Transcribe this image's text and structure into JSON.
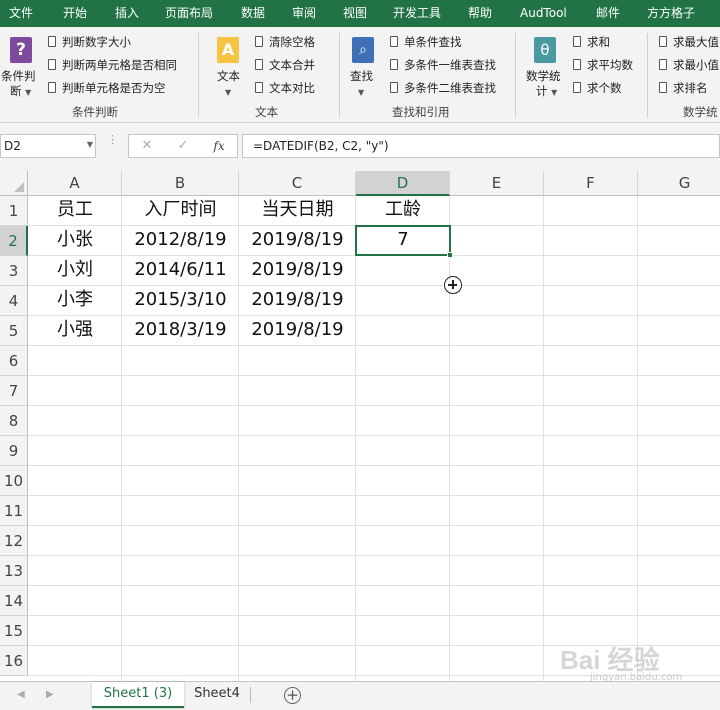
{
  "menu": {
    "items": [
      "文件",
      "开始",
      "插入",
      "页面布局",
      "数据",
      "审阅",
      "视图",
      "开发工具",
      "帮助",
      "AudTool",
      "邮件",
      "方方格子"
    ]
  },
  "ribbon": {
    "groups": {
      "condition": {
        "big_button_label_line1": "条件判",
        "big_button_label_line2": "断",
        "items": [
          "判断数字大小",
          "判断两单元格是否相同",
          "判断单元格是否为空"
        ],
        "group_label": "条件判断"
      },
      "text": {
        "big_button_label": "文本",
        "items": [
          "清除空格",
          "文本合并",
          "文本对比"
        ],
        "group_label": "文本"
      },
      "lookup": {
        "big_button_label": "查找",
        "items": [
          "单条件查找",
          "多条件一维表查找",
          "多条件二维表查找"
        ],
        "group_label": "查找和引用"
      },
      "stats": {
        "big_button_label_line1": "数学统",
        "big_button_label_line2": "计",
        "items": [
          "求和",
          "求平均数",
          "求个数"
        ]
      },
      "stats2": {
        "items": [
          "求最大值",
          "求最小值",
          "求排名"
        ],
        "group_label": "数学统"
      }
    }
  },
  "formula_bar": {
    "name_box": "D2",
    "formula": "=DATEDIF(B2, C2, \"y\")",
    "cancel_glyph": "✕",
    "enter_glyph": "✓",
    "fx_glyph": "fx"
  },
  "sheet": {
    "columns": [
      "A",
      "B",
      "C",
      "D",
      "E",
      "F",
      "G"
    ],
    "rows": [
      "1",
      "2",
      "3",
      "4",
      "5",
      "6",
      "7",
      "8",
      "9",
      "10",
      "11",
      "12",
      "13",
      "14",
      "15",
      "16"
    ],
    "header_row": [
      "员工",
      "入厂时间",
      "当天日期",
      "工龄"
    ],
    "data": [
      [
        "小张",
        "2012/8/19",
        "2019/8/19",
        "7"
      ],
      [
        "小刘",
        "2014/6/11",
        "2019/8/19",
        ""
      ],
      [
        "小李",
        "2015/3/10",
        "2019/8/19",
        ""
      ],
      [
        "小强",
        "2018/3/19",
        "2019/8/19",
        ""
      ]
    ],
    "selected_cell": "D2"
  },
  "tabs": {
    "items": [
      "Sheet1 (3)",
      "Sheet4"
    ],
    "active": "Sheet1 (3)",
    "add_glyph": "+"
  },
  "watermark": {
    "text": "Bai 经验",
    "url": "jingyan.baidu.com"
  },
  "colors": {
    "excel_green": "#217346",
    "ribbon_bg": "#f3f3f3",
    "icon_purple": "#7e4a9e",
    "icon_yellow": "#f6c342",
    "icon_blue": "#3f6fb5",
    "icon_teal": "#4a9aa0"
  }
}
